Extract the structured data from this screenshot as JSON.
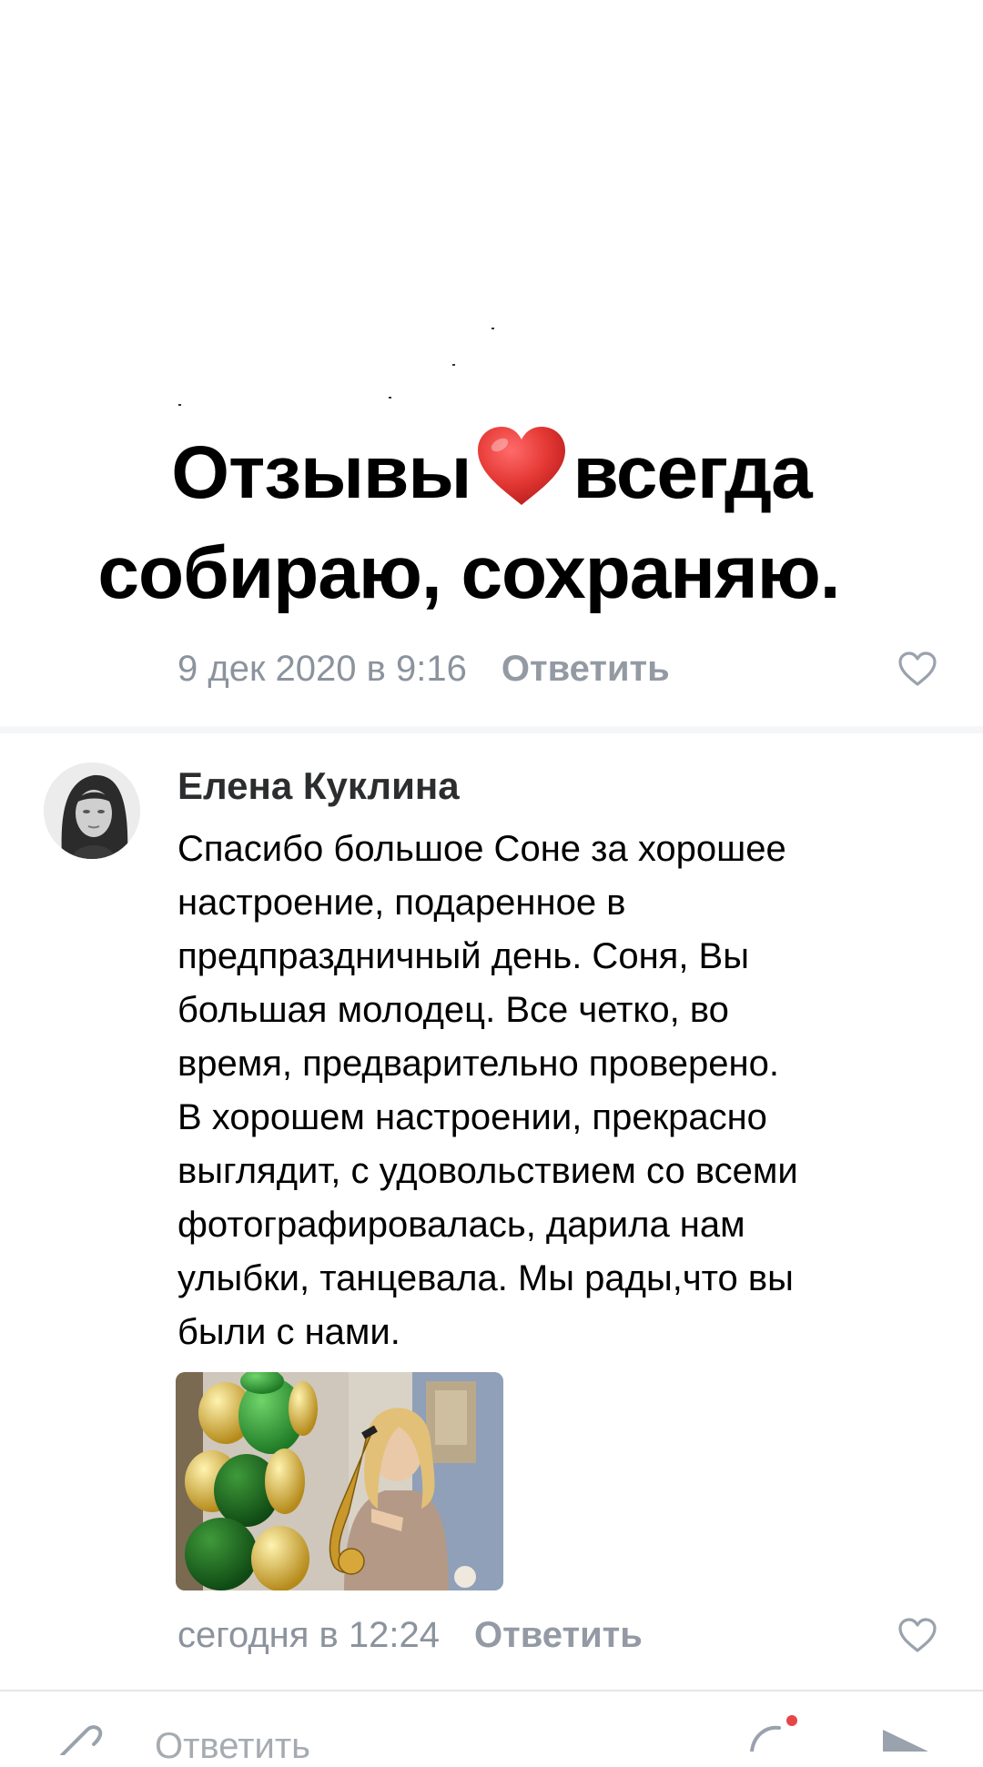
{
  "post": {
    "headline_line1_part1": "Отзывы",
    "headline_line1_part2": "всегда",
    "headline_line2": "собираю, сохраняю.",
    "time": "9 дек 2020 в 9:16",
    "reply_label": "Ответить"
  },
  "comment": {
    "author": "Елена Куклина",
    "text_lines": [
      "Спасибо большое Соне за хорошее",
      "настроение, подаренное в",
      "предпраздничный день. Соня, Вы",
      "большая молодец. Все четко, во",
      "время, предварительно проверено.",
      "В хорошем настроении, прекрасно",
      "выглядит,  с удовольствием со всеми",
      "фотографировалась, дарила нам",
      "улыбки, танцевала. Мы рады,что вы",
      "были с нами."
    ],
    "time": "сегодня в 12:24",
    "reply_label": "Ответить"
  },
  "composer": {
    "placeholder": "Ответить"
  },
  "icons": {
    "headline_heart": "heart-emoji-icon",
    "like": "heart-outline-icon",
    "attach": "paperclip-icon",
    "emoji": "emoji-icon",
    "send": "send-icon"
  },
  "colors": {
    "meta_text": "#8b939d",
    "heart_red": "#e53935",
    "notification_dot": "#e64646"
  }
}
